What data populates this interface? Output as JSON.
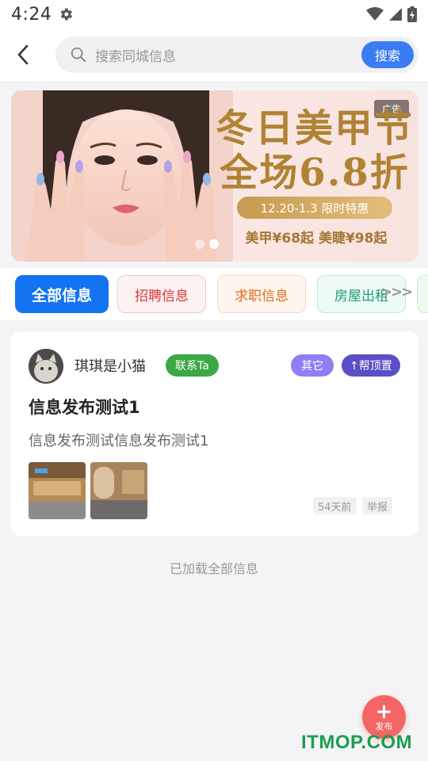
{
  "status_bar": {
    "time": "4:24",
    "icons": [
      "gear-icon",
      "wifi-icon",
      "signal-icon",
      "battery-charging-icon"
    ]
  },
  "header": {
    "back_icon": "chevron-left-icon",
    "search": {
      "placeholder": "搜索同城信息",
      "button_label": "搜索",
      "icon": "search-icon"
    }
  },
  "banner": {
    "ad_tag": "广告",
    "title_line1": "冬日美甲节",
    "title_line2": "全场6.8折",
    "subtitle": "12.20-1.3 限时特惠",
    "prices": "美甲¥68起 美睫¥98起",
    "slide_count": 2,
    "active_slide": 1
  },
  "tabs": {
    "items": [
      {
        "label": "全部信息",
        "active": true
      },
      {
        "label": "招聘信息",
        "active": false
      },
      {
        "label": "求职信息",
        "active": false
      },
      {
        "label": "房屋出租",
        "active": false
      }
    ],
    "more_indicator": ">>>"
  },
  "post": {
    "username": "琪琪是小猫",
    "contact_label": "联系Ta",
    "category": "其它",
    "pin_label": "↑帮顶置",
    "title": "信息发布测试1",
    "description": "信息发布测试信息发布测试1",
    "image_count": 2,
    "time_ago": "54天前",
    "report_label": "举报"
  },
  "footer": {
    "load_all": "已加载全部信息"
  },
  "fab": {
    "plus": "+",
    "label": "发布"
  },
  "watermark": "ITMOP.COM",
  "colors": {
    "accent_blue": "#1473f0",
    "search_blue": "#3a7cf5",
    "contact_green": "#3aa845",
    "fab_red": "#f46565",
    "banner_gold": "#b08233"
  }
}
